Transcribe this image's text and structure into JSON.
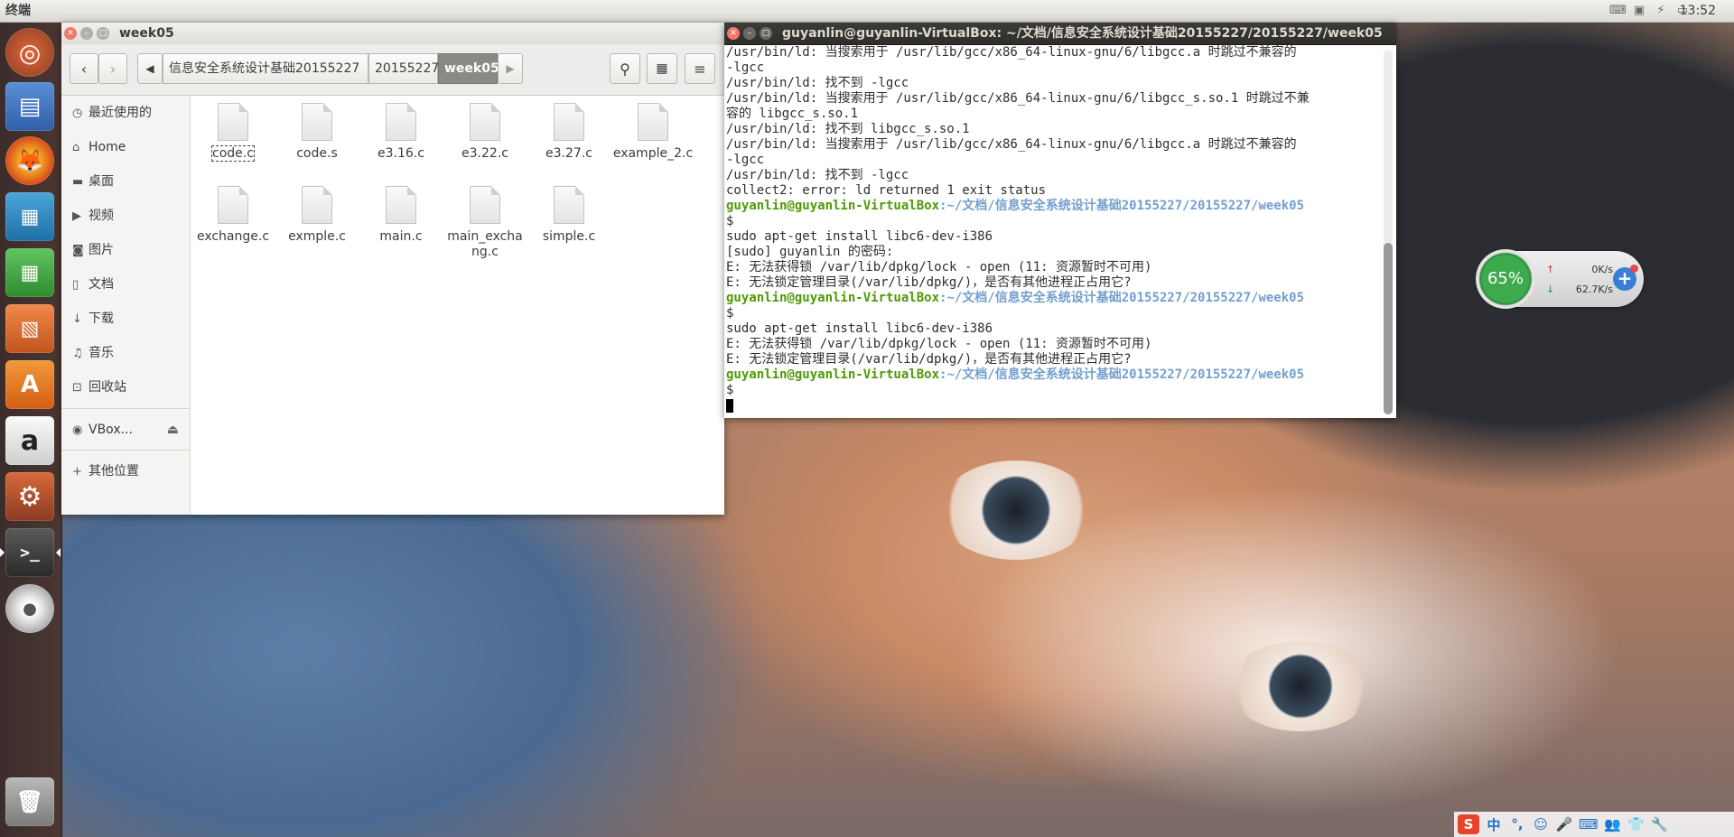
{
  "top_panel": {
    "title": "终端",
    "clock": "13:52",
    "tray_icons": [
      "keyboard-icon",
      "network-icon",
      "battery-icon",
      "volume-icon"
    ]
  },
  "launcher": {
    "items": [
      {
        "name": "ubuntu-dash",
        "label": ""
      },
      {
        "name": "files",
        "label": ""
      },
      {
        "name": "firefox",
        "label": ""
      },
      {
        "name": "libreoffice-impress",
        "label": ""
      },
      {
        "name": "libreoffice-calc",
        "label": ""
      },
      {
        "name": "libreoffice-draw",
        "label": ""
      },
      {
        "name": "software-center",
        "label": "A"
      },
      {
        "name": "amazon",
        "label": "a"
      },
      {
        "name": "system-settings",
        "label": ""
      },
      {
        "name": "terminal",
        "label": ">_"
      },
      {
        "name": "dvd",
        "label": ""
      },
      {
        "name": "trash",
        "label": ""
      }
    ]
  },
  "files": {
    "title": "week05",
    "breadcrumbs": [
      "信息安全系统设计基础20155227",
      "20155227",
      "week05"
    ],
    "sidebar": [
      {
        "label": "最近使用的",
        "icon": "clock-icon"
      },
      {
        "label": "Home",
        "icon": "home-icon"
      },
      {
        "label": "桌面",
        "icon": "desktop-icon"
      },
      {
        "label": "视频",
        "icon": "video-icon"
      },
      {
        "label": "图片",
        "icon": "camera-icon"
      },
      {
        "label": "文档",
        "icon": "document-icon"
      },
      {
        "label": "下载",
        "icon": "download-icon"
      },
      {
        "label": "音乐",
        "icon": "music-icon"
      },
      {
        "label": "回收站",
        "icon": "trash-icon"
      },
      {
        "label": "VBox...",
        "icon": "disc-icon"
      },
      {
        "label": "其他位置",
        "icon": "plus-icon"
      }
    ],
    "files": [
      {
        "name": "code.c",
        "selected": true
      },
      {
        "name": "code.s"
      },
      {
        "name": "e3.16.c"
      },
      {
        "name": "e3.22.c"
      },
      {
        "name": "e3.27.c"
      },
      {
        "name": "example_2.c"
      },
      {
        "name": "exchange.c"
      },
      {
        "name": "exmple.c"
      },
      {
        "name": "main.c"
      },
      {
        "name": "main_exchang.c"
      },
      {
        "name": "simple.c"
      }
    ]
  },
  "terminal": {
    "title": "guyanlin@guyanlin-VirtualBox: ~/文档/信息安全系统设计基础20155227/20155227/week05",
    "prompt_user": "guyanlin@guyanlin-VirtualBox",
    "prompt_path": ":~/文档/信息安全系统设计基础20155227/20155227/week05",
    "lines": [
      {
        "t": "text",
        "v": "/usr/bin/ld: 当搜索用于 /usr/lib/gcc/x86_64-linux-gnu/6/libgcc.a 时跳过不兼容的"
      },
      {
        "t": "text",
        "v": "-lgcc"
      },
      {
        "t": "text",
        "v": "/usr/bin/ld: 找不到 -lgcc"
      },
      {
        "t": "text",
        "v": "/usr/bin/ld: 当搜索用于 /usr/lib/gcc/x86_64-linux-gnu/6/libgcc_s.so.1 时跳过不兼"
      },
      {
        "t": "text",
        "v": "容的 libgcc_s.so.1"
      },
      {
        "t": "text",
        "v": "/usr/bin/ld: 找不到 libgcc_s.so.1"
      },
      {
        "t": "text",
        "v": "/usr/bin/ld: 当搜索用于 /usr/lib/gcc/x86_64-linux-gnu/6/libgcc.a 时跳过不兼容的"
      },
      {
        "t": "text",
        "v": "-lgcc"
      },
      {
        "t": "text",
        "v": "/usr/bin/ld: 找不到 -lgcc"
      },
      {
        "t": "text",
        "v": "collect2: error: ld returned 1 exit status"
      },
      {
        "t": "prompt",
        "v": ""
      },
      {
        "t": "text",
        "v": "$"
      },
      {
        "t": "text",
        "v": "sudo apt-get install libc6-dev-i386"
      },
      {
        "t": "text",
        "v": "[sudo] guyanlin 的密码:"
      },
      {
        "t": "text",
        "v": "E: 无法获得锁 /var/lib/dpkg/lock - open (11: 资源暂时不可用)"
      },
      {
        "t": "text",
        "v": "E: 无法锁定管理目录(/var/lib/dpkg/)，是否有其他进程正占用它?"
      },
      {
        "t": "prompt",
        "v": ""
      },
      {
        "t": "text",
        "v": "$"
      },
      {
        "t": "text",
        "v": "sudo apt-get install libc6-dev-i386"
      },
      {
        "t": "text",
        "v": "E: 无法获得锁 /var/lib/dpkg/lock - open (11: 资源暂时不可用)"
      },
      {
        "t": "text",
        "v": "E: 无法锁定管理目录(/var/lib/dpkg/)，是否有其他进程正占用它?"
      },
      {
        "t": "prompt",
        "v": ""
      },
      {
        "t": "text",
        "v": "$"
      },
      {
        "t": "cursor",
        "v": ""
      }
    ]
  },
  "net_widget": {
    "percent": "65%",
    "up": "0K/s",
    "down": "62.7K/s"
  },
  "ime_tray": [
    "S",
    "中",
    "°,",
    "☺",
    "🎤",
    "⌨",
    "👥",
    "👕",
    "🔧"
  ],
  "colors": {
    "prompt_user": "#4e9a06",
    "prompt_path": "#729fcf",
    "selected_crumb": "#8b8985",
    "widget_green": "#3daa4e"
  }
}
